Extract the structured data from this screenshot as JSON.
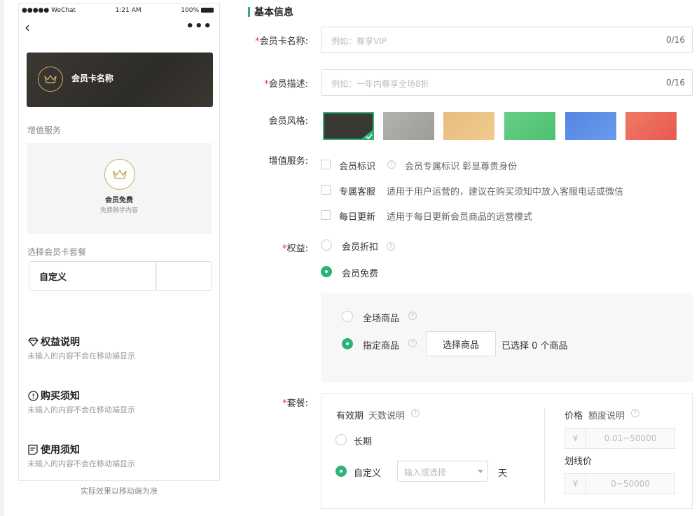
{
  "phone": {
    "status": {
      "carrier": "●●●●● WeChat",
      "time": "1:21 AM",
      "battery": "100%"
    },
    "card_name": "会员卡名称",
    "value_service_title": "增值服务",
    "service": {
      "title": "会员免费",
      "desc": "免费畅学内容"
    },
    "package_title": "选择会员卡套餐",
    "package_option": "自定义",
    "sections": [
      {
        "title": "权益说明",
        "desc": "未输入的内容不会在移动端显示"
      },
      {
        "title": "购买须知",
        "desc": "未输入的内容不会在移动端显示"
      },
      {
        "title": "使用须知",
        "desc": "未输入的内容不会在移动端显示"
      }
    ],
    "footer": "实际效果以移动端为准"
  },
  "form": {
    "heading": "基本信息",
    "name": {
      "label": "会员卡名称:",
      "placeholder": "例如：尊享VIP",
      "count": "0/16"
    },
    "desc": {
      "label": "会员描述:",
      "placeholder": "例如：一年内尊享全场8折",
      "count": "0/16"
    },
    "style": {
      "label": "会员风格:",
      "colors": [
        "#3a3833",
        "#a8a7a3",
        "#e9c185",
        "#5ec97c",
        "#5b8de6",
        "#ec6a5b"
      ]
    },
    "services": {
      "label": "增值服务:",
      "items": [
        {
          "name": "会员标识",
          "desc": "会员专属标识 彰显尊贵身份"
        },
        {
          "name": "专属客服",
          "desc": "适用于用户运营的，建议在购买须知中放入客服电话或微信"
        },
        {
          "name": "每日更新",
          "desc": "适用于每日更新会员商品的运营模式"
        }
      ]
    },
    "rights": {
      "label": "权益:",
      "discount": "会员折扣",
      "free": "会员免费",
      "all_goods": "全场商品",
      "specified_goods": "指定商品",
      "select_button": "选择商品",
      "selected_text": "已选择 0 个商品"
    },
    "package": {
      "label": "套餐:",
      "validity": "有效期",
      "days_desc": "天数说明",
      "long_term": "长期",
      "custom": "自定义",
      "input_placeholder": "输入或选择",
      "unit": "天",
      "price": "价格",
      "quota_desc": "额度说明",
      "price_placeholder": "0.01~50000",
      "strike_price": "划线价",
      "strike_placeholder": "0~50000",
      "currency": "¥"
    }
  }
}
